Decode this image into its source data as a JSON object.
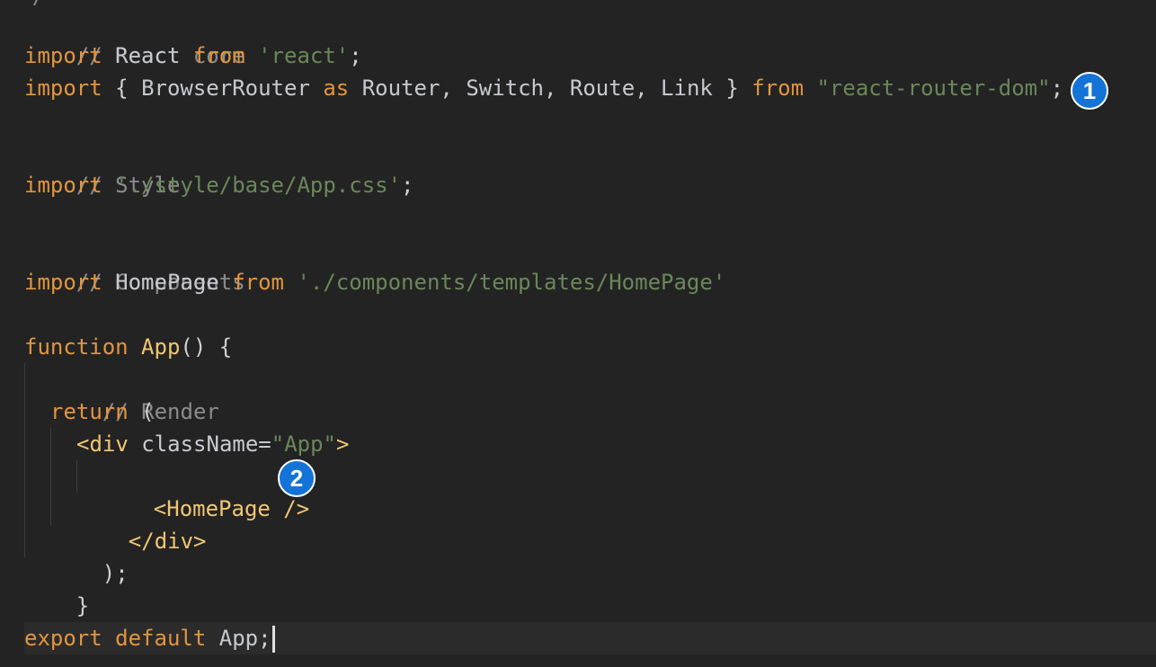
{
  "code": {
    "top_fragment": "/ ...",
    "line1_comment": "// React core",
    "line2": {
      "kw_import": "import",
      "id": "React",
      "kw_from": "from",
      "str": "'react'",
      "end": ";"
    },
    "line3": {
      "kw_import": "import",
      "brace_open": "{",
      "id1": "BrowserRouter",
      "kw_as": "as",
      "rest": "Router, Switch, Route, Link",
      "brace_close": "}",
      "kw_from": "from",
      "str": "\"react-router-dom\"",
      "end": ";"
    },
    "line5_comment": "// Style",
    "line6": {
      "kw_import": "import",
      "str": "'./style/base/App.css'",
      "end": ";"
    },
    "line8_comment": "// Components",
    "line9": {
      "kw_import": "import",
      "id": "HomePage",
      "kw_from": "from",
      "str": "'./components/templates/HomePage'"
    },
    "line11": {
      "kw_function": "function",
      "fn_name": "App",
      "rest": "() {"
    },
    "line12_comment": "// Render",
    "line13": {
      "kw_return": "return",
      "rest": "("
    },
    "line14": {
      "tag_open": "<div",
      "attr": "className=",
      "str": "\"App\"",
      "tag_close": ">"
    },
    "line15": {
      "tag": "<HomePage />"
    },
    "line16": {
      "tag": "</div>"
    },
    "line17": ");",
    "line18": "}",
    "line20": {
      "kw_export": "export",
      "kw_default": "default",
      "id": "App",
      "end": ";"
    }
  },
  "badges": {
    "badge1": "1",
    "badge2": "2"
  },
  "colors": {
    "background": "#232323",
    "keyword": "#e2953e",
    "string": "#6a8759",
    "comment": "#8b8b8b",
    "identifier": "#c7c9cf",
    "tag": "#f0c674",
    "badge": "#1473d6"
  }
}
